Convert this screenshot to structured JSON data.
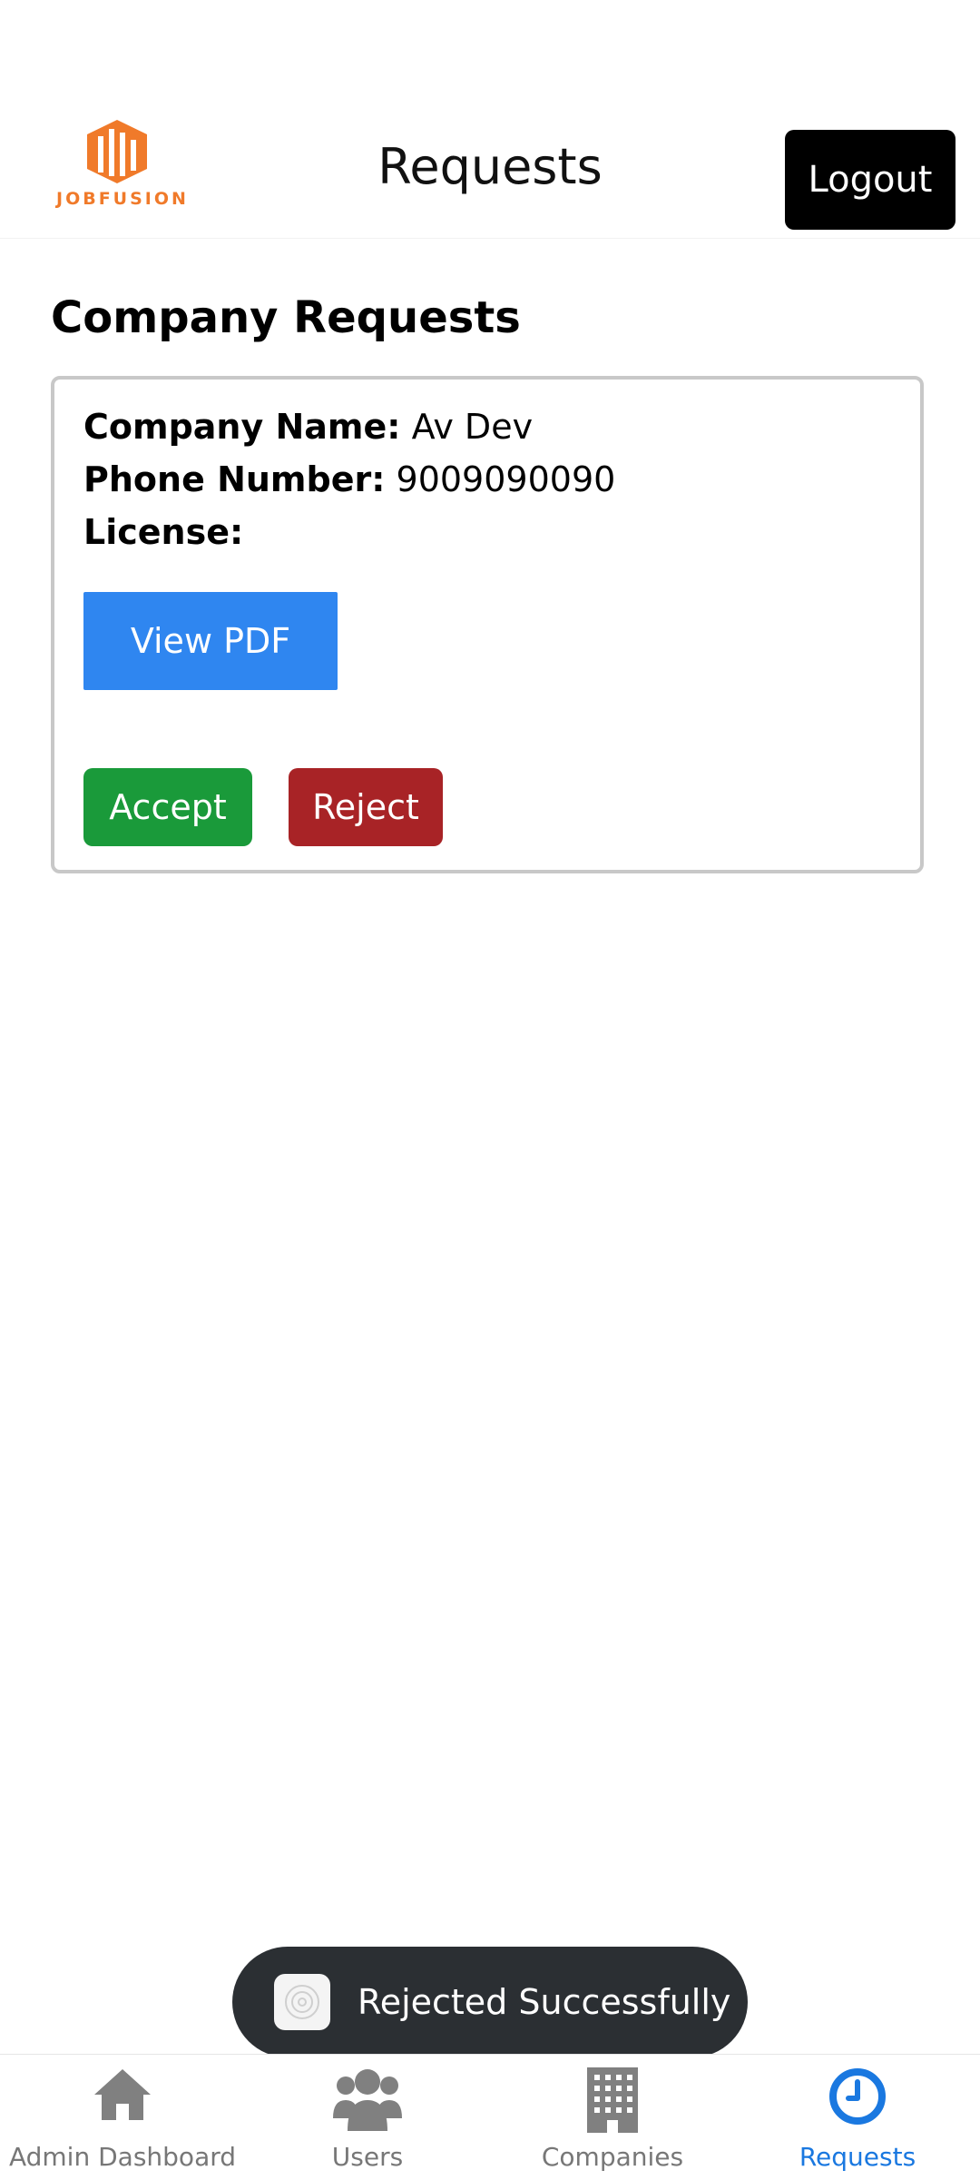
{
  "header": {
    "logo_text": "JOBFUSION",
    "title": "Requests",
    "logout_label": "Logout"
  },
  "main": {
    "section_title": "Company Requests",
    "request": {
      "company_name_label": "Company Name:",
      "company_name_value": "Av Dev",
      "phone_label": "Phone Number:",
      "phone_value": "9009090090",
      "license_label": "License:",
      "view_pdf_label": "View PDF",
      "accept_label": "Accept",
      "reject_label": "Reject"
    }
  },
  "toast": {
    "message": "Rejected Successfully"
  },
  "bottom_nav": {
    "items": [
      {
        "label": "Admin Dashboard",
        "icon": "home-icon"
      },
      {
        "label": "Users",
        "icon": "users-icon"
      },
      {
        "label": "Companies",
        "icon": "building-icon"
      },
      {
        "label": "Requests",
        "icon": "clock-icon"
      }
    ],
    "active": "Requests"
  },
  "colors": {
    "accent": "#1a78e0",
    "accept": "#1a9a3a",
    "reject": "#a82326",
    "view_pdf": "#2f86f0",
    "logo": "#f07a2a"
  }
}
